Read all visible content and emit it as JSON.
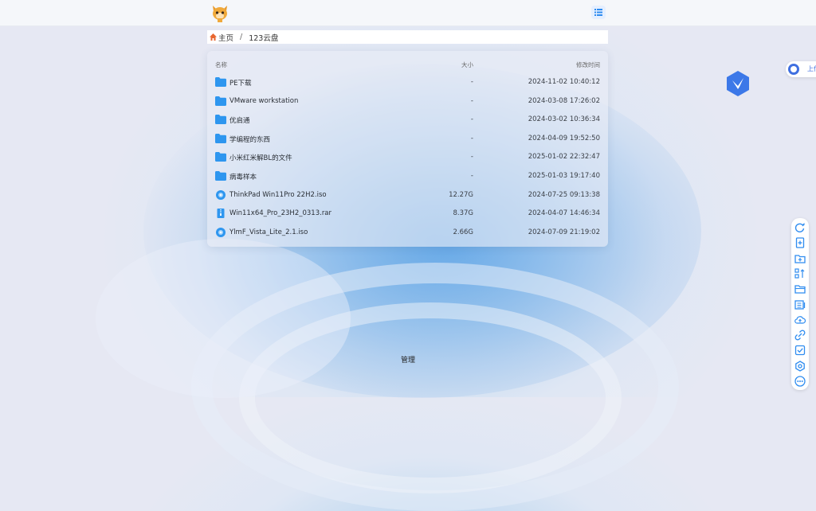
{
  "topbar": {
    "logo_icon": "cat-avatar-icon",
    "view_toggle_icon": "list-view-icon"
  },
  "breadcrumb": {
    "home_label": "主页",
    "separator": "/",
    "current": "123云盘"
  },
  "file_table": {
    "columns": {
      "name": "名称",
      "size": "大小",
      "modified": "修改时间"
    },
    "rows": [
      {
        "type": "folder",
        "name": "PE下载",
        "size": "-",
        "modified": "2024-11-02 10:40:12"
      },
      {
        "type": "folder",
        "name": "VMware workstation",
        "size": "-",
        "modified": "2024-03-08 17:26:02"
      },
      {
        "type": "folder",
        "name": "优启通",
        "size": "-",
        "modified": "2024-03-02 10:36:34"
      },
      {
        "type": "folder",
        "name": "学编程的东西",
        "size": "-",
        "modified": "2024-04-09 19:52:50"
      },
      {
        "type": "folder",
        "name": "小米红米解BL的文件",
        "size": "-",
        "modified": "2025-01-02 22:32:47"
      },
      {
        "type": "folder",
        "name": "病毒样本",
        "size": "-",
        "modified": "2025-01-03 19:17:40"
      },
      {
        "type": "disc",
        "name": "ThinkPad Win11Pro 22H2.iso",
        "size": "12.27G",
        "modified": "2024-07-25 09:13:38"
      },
      {
        "type": "archive",
        "name": "Win11x64_Pro_23H2_0313.rar",
        "size": "8.37G",
        "modified": "2024-04-07 14:46:34"
      },
      {
        "type": "disc",
        "name": "YlmF_Vista_Lite_2.1.iso",
        "size": "2.66G",
        "modified": "2024-07-09 21:19:02"
      }
    ]
  },
  "upload_float": {
    "label": "上传"
  },
  "side_toolbar": {
    "icons": [
      "refresh-icon",
      "new-file-icon",
      "new-folder-icon",
      "sort-icon",
      "folder-icon",
      "queue-icon",
      "upload-icon",
      "link-icon",
      "select-icon",
      "settings-icon",
      "more-icon"
    ]
  },
  "footer": {
    "manage_label": "管理"
  },
  "colors": {
    "accent": "#2f8cf0",
    "folder": "#2e96ef",
    "background": "#e4e7f2"
  }
}
